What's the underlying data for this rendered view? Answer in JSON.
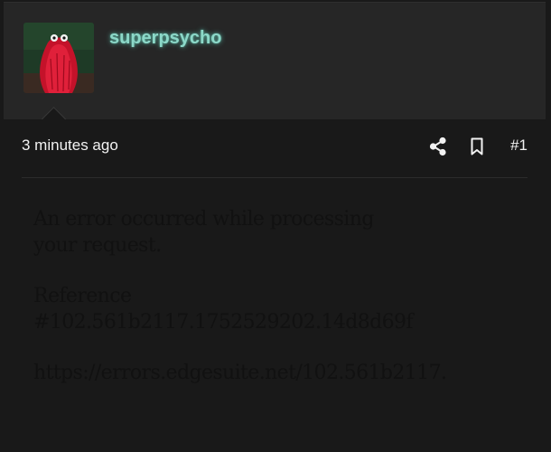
{
  "post": {
    "username": "superpsycho",
    "timestamp": "3 minutes ago",
    "post_number": "#1",
    "body": {
      "error_line_1": "An error occurred while processing",
      "error_line_2": "your request.",
      "reference_label": "Reference",
      "reference_code": "#102.561b2117.1752529202.14d8d69f",
      "error_url": "https://errors.edgesuite.net/102.561b2117."
    }
  },
  "icons": {
    "share": "share-icon",
    "bookmark": "bookmark-icon"
  },
  "colors": {
    "page_background": "#191919",
    "header_background": "#262626",
    "username": "#8cd8c8",
    "meta_text": "#f2f2f2",
    "body_text": "#111111"
  }
}
